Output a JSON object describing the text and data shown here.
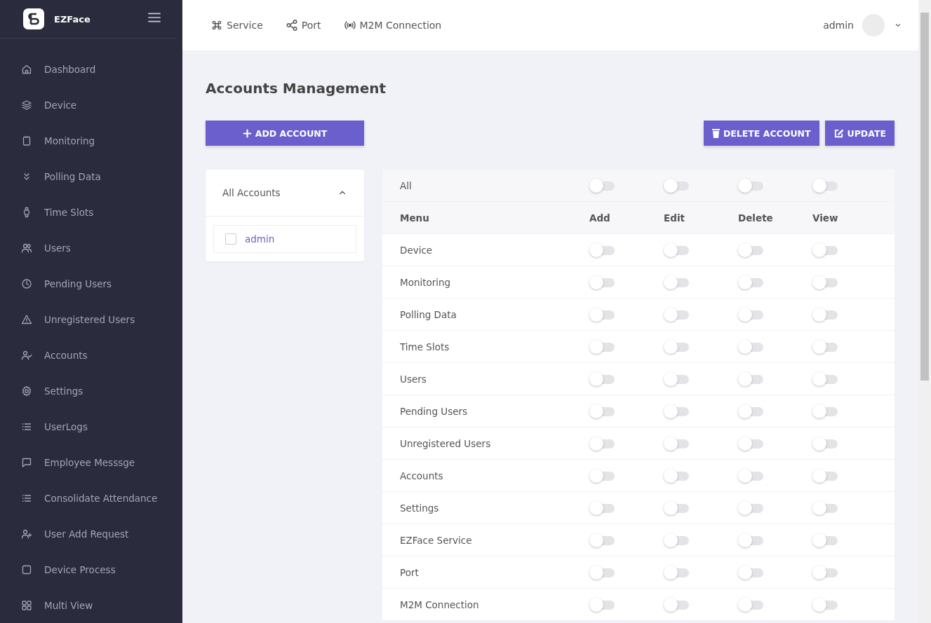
{
  "brand": {
    "name": "EZFace"
  },
  "sidebar": {
    "items": [
      {
        "label": "Dashboard",
        "selected": false
      },
      {
        "label": "Device",
        "selected": false
      },
      {
        "label": "Monitoring",
        "selected": false
      },
      {
        "label": "Polling Data",
        "selected": false
      },
      {
        "label": "Time Slots",
        "selected": false
      },
      {
        "label": "Users",
        "selected": false
      },
      {
        "label": "Pending Users",
        "selected": false
      },
      {
        "label": "Unregistered Users",
        "selected": false
      },
      {
        "label": "Accounts",
        "selected": false
      },
      {
        "label": "Settings",
        "selected": false
      },
      {
        "label": "UserLogs",
        "selected": false
      },
      {
        "label": "Employee Messsge",
        "selected": false
      },
      {
        "label": "Consolidate Attendance",
        "selected": false
      },
      {
        "label": "User Add Request",
        "selected": false
      },
      {
        "label": "Device Process",
        "selected": false
      },
      {
        "label": "Multi View",
        "selected": false
      }
    ]
  },
  "topbar": {
    "links": [
      "Service",
      "Port",
      "M2M Connection"
    ],
    "user": "admin"
  },
  "page": {
    "title": "Accounts Management",
    "add_button": "ADD ACCOUNT",
    "delete_button": "DELETE ACCOUNT",
    "update_button": "UPDATE"
  },
  "accounts": {
    "header": "All Accounts",
    "expanded": true,
    "items": [
      {
        "name": "admin",
        "checked": false
      }
    ]
  },
  "permissions": {
    "all_label": "All",
    "all_toggles": [
      {
        "on": false
      },
      {
        "on": false
      },
      {
        "on": false
      },
      {
        "on": false
      }
    ],
    "columns": [
      "Menu",
      "Add",
      "Edit",
      "Delete",
      "View"
    ],
    "rows": [
      {
        "menu": "Device",
        "toggles": [
          {
            "on": false
          },
          {
            "on": false
          },
          {
            "on": false
          },
          {
            "on": false
          }
        ]
      },
      {
        "menu": "Monitoring",
        "toggles": [
          {
            "on": false
          },
          {
            "on": false
          },
          {
            "on": false
          },
          {
            "on": false
          }
        ]
      },
      {
        "menu": "Polling Data",
        "toggles": [
          {
            "on": false
          },
          {
            "on": false
          },
          {
            "on": false
          },
          {
            "on": false
          }
        ]
      },
      {
        "menu": "Time Slots",
        "toggles": [
          {
            "on": false
          },
          {
            "on": false
          },
          {
            "on": false
          },
          {
            "on": false
          }
        ]
      },
      {
        "menu": "Users",
        "toggles": [
          {
            "on": false
          },
          {
            "on": false
          },
          {
            "on": false
          },
          {
            "on": false
          }
        ]
      },
      {
        "menu": "Pending Users",
        "toggles": [
          {
            "on": false
          },
          {
            "on": false
          },
          {
            "on": false
          },
          {
            "on": false
          }
        ]
      },
      {
        "menu": "Unregistered Users",
        "toggles": [
          {
            "on": false
          },
          {
            "on": false
          },
          {
            "on": false
          },
          {
            "on": false
          }
        ]
      },
      {
        "menu": "Accounts",
        "toggles": [
          {
            "on": false
          },
          {
            "on": false
          },
          {
            "on": false
          },
          {
            "on": false
          }
        ]
      },
      {
        "menu": "Settings",
        "toggles": [
          {
            "on": false
          },
          {
            "on": false
          },
          {
            "on": false
          },
          {
            "on": false
          }
        ]
      },
      {
        "menu": "EZFace Service",
        "toggles": [
          {
            "on": false
          },
          {
            "on": false
          },
          {
            "on": false
          },
          {
            "on": false
          }
        ]
      },
      {
        "menu": "Port",
        "toggles": [
          {
            "on": false
          },
          {
            "on": false
          },
          {
            "on": false
          },
          {
            "on": false
          }
        ]
      },
      {
        "menu": "M2M Connection",
        "toggles": [
          {
            "on": false
          },
          {
            "on": false
          },
          {
            "on": false
          },
          {
            "on": false
          }
        ]
      }
    ]
  }
}
